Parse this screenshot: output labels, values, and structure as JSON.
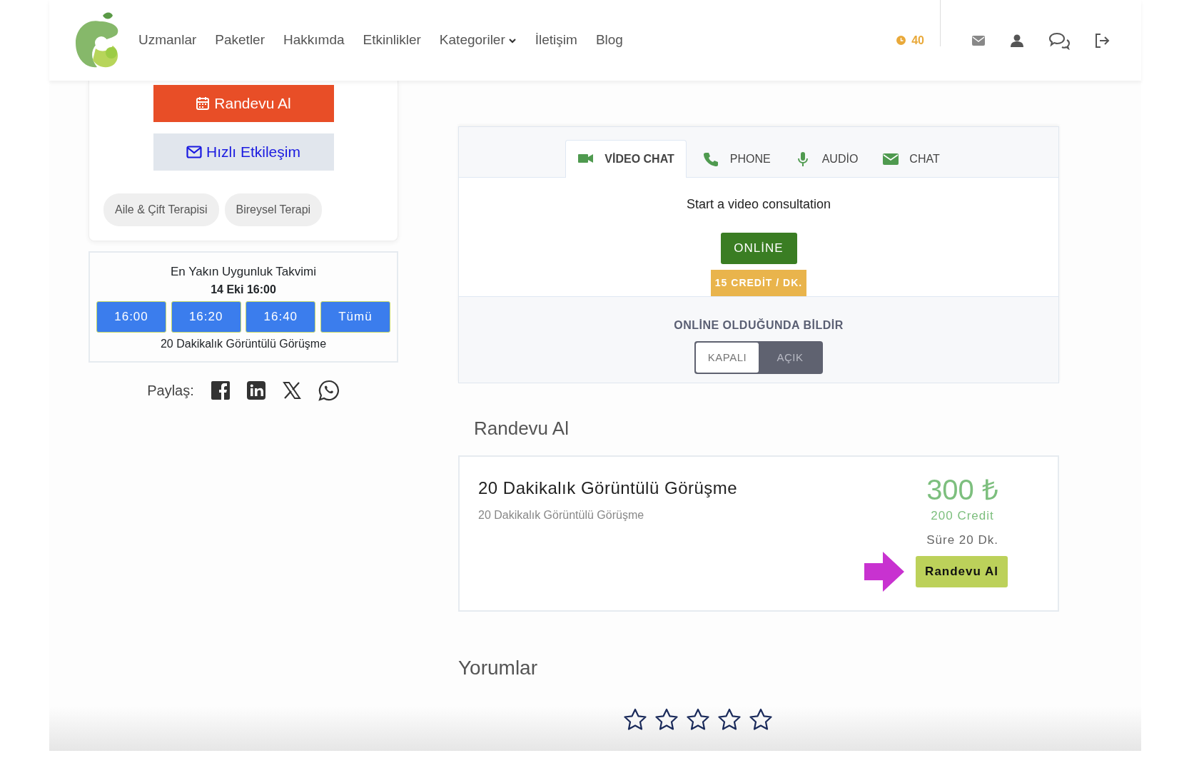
{
  "header": {
    "nav": [
      {
        "label": "Uzmanlar",
        "dropdown": false
      },
      {
        "label": "Paketler",
        "dropdown": false
      },
      {
        "label": "Hakkımda",
        "dropdown": false
      },
      {
        "label": "Etkinlikler",
        "dropdown": false
      },
      {
        "label": "Kategoriler",
        "dropdown": true
      },
      {
        "label": "İletişim",
        "dropdown": false
      },
      {
        "label": "Blog",
        "dropdown": false
      }
    ],
    "credits": "40"
  },
  "profile": {
    "buttons": [
      "Randevu Al",
      "Hızlı Etkileşim"
    ],
    "tags": [
      "Aile & Çift Terapisi",
      "Bireysel Terapi"
    ]
  },
  "availability": {
    "title": "En Yakın Uygunluk Takvimi",
    "date": "14 Eki 16:00",
    "slots": [
      "16:00",
      "16:20",
      "16:40",
      "Tümü"
    ],
    "session": "20 Dakikalık Görüntülü Görüşme"
  },
  "share": {
    "label": "Paylaş:"
  },
  "consult": {
    "tabs": [
      {
        "label": "VİDEO CHAT",
        "selected": true
      },
      {
        "label": "PHONE",
        "selected": false
      },
      {
        "label": "AUDİO",
        "selected": false
      },
      {
        "label": "CHAT",
        "selected": false
      }
    ],
    "prompt": "Start a video consultation",
    "status": "ONLİNE",
    "rate": "15 CREDİT / DK.",
    "notify": {
      "title": "ONLİNE OLDUĞUNDA BİLDİR",
      "options": [
        {
          "label": "KAPALI",
          "selected": true
        },
        {
          "label": "AÇIK",
          "selected": false
        }
      ]
    }
  },
  "booking": {
    "heading": "Randevu Al",
    "packages": [
      {
        "title": "20 Dakikalık Görüntülü Görüşme",
        "subtitle": "20 Dakikalık Görüntülü Görüşme",
        "price": "300 ₺",
        "credit": "200 Credit",
        "duration": "Süre 20 Dk.",
        "button": "Randevu Al"
      }
    ]
  },
  "reviews": {
    "heading": "Yorumlar",
    "stars": 0
  }
}
